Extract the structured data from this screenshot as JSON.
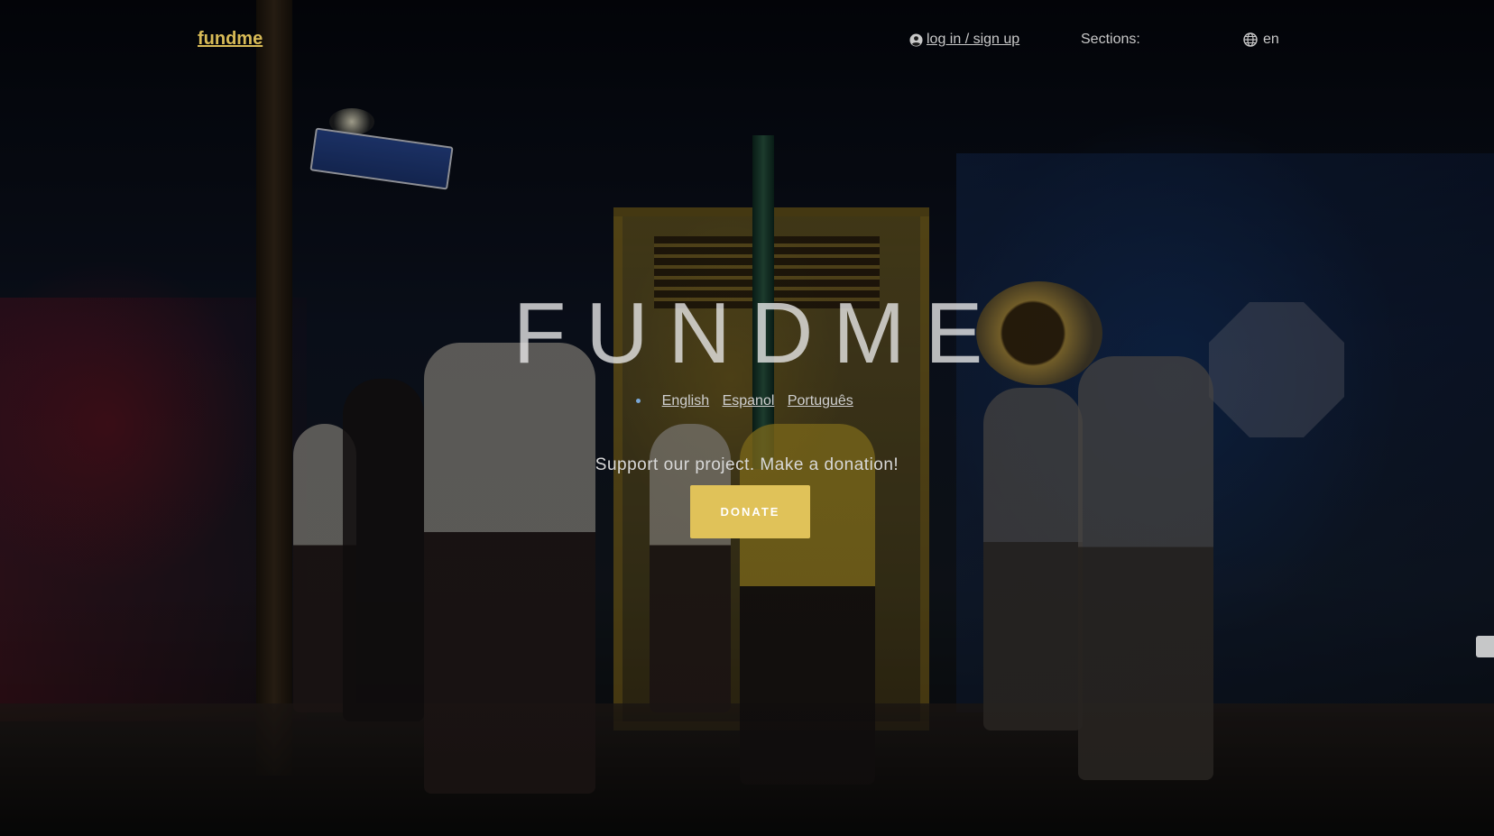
{
  "nav": {
    "brand": "fundme",
    "login_label": "log in / sign up",
    "sections_label": "Sections:",
    "language_current": "en"
  },
  "hero": {
    "title": "FUNDME",
    "languages": [
      "English",
      "Espanol",
      "Português"
    ],
    "tagline": "Support our project. Make a donation!",
    "donate_label": "DONATE"
  },
  "colors": {
    "accent": "#e0c259",
    "brand_text": "#d8bb57",
    "nav_text": "#c9c9c9"
  },
  "icons": {
    "login": "user-circle-icon",
    "language": "globe-icon"
  }
}
